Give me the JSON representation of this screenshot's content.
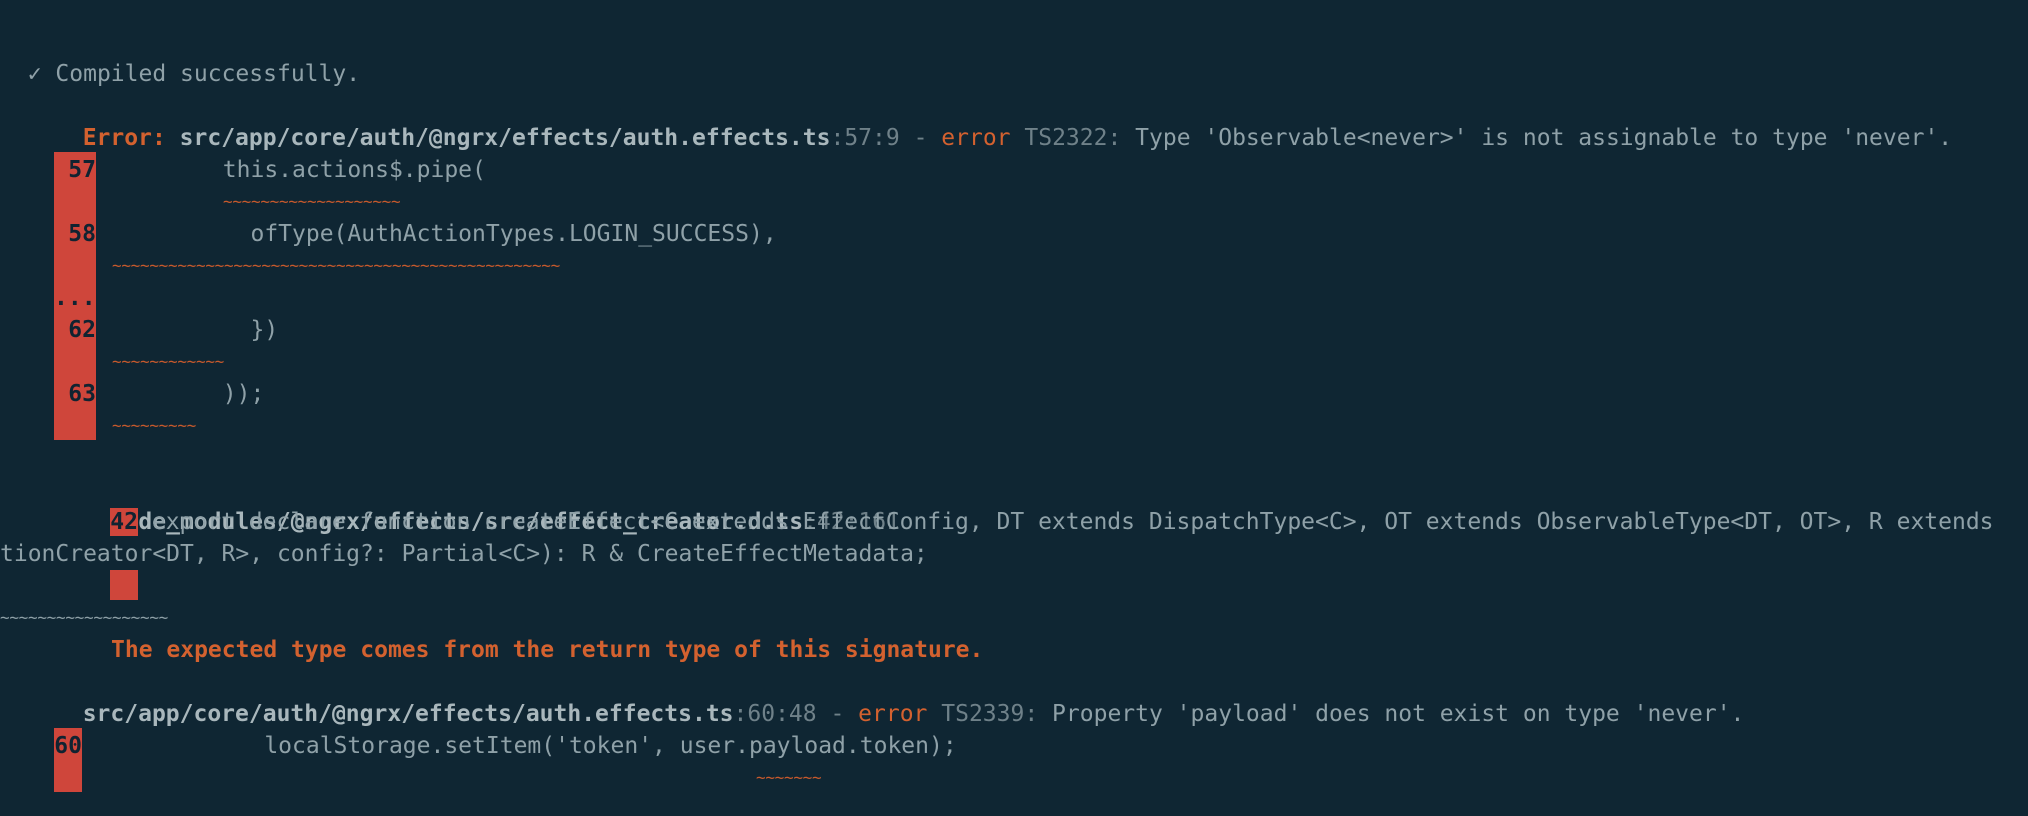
{
  "status": {
    "check_icon": "✓",
    "compiled_message": "Compiled successfully."
  },
  "colors": {
    "background": "#0f2633",
    "error": "#d3612f",
    "gutter": "#cf463b",
    "text": "#8fa1a8"
  },
  "error1": {
    "label": "Error:",
    "file": "src/app/core/auth/@ngrx/effects/auth.effects.ts",
    "position": ":57:9",
    "dash": " - ",
    "keyword": "error",
    "code": " TS2322:",
    "message": " Type 'Observable<never>' is not assignable to type 'never'.",
    "lines": [
      {
        "num": "57",
        "code": "        this.actions$.pipe(",
        "squiggle": "~~~~~~~~~~~~~~~~~~~"
      },
      {
        "num": "58",
        "code": "          ofType(AuthActionTypes.LOGIN_SUCCESS),",
        "squiggle": "~~~~~~~~~~~~~~~~~~~~~~~~~~~~~~~~~~~~~~~~~~~~~~~~"
      },
      {
        "num": "62",
        "code": "          })",
        "squiggle": "~~~~~~~~~~~~"
      },
      {
        "num": "63",
        "code": "        ));",
        "squiggle": "~~~~~~~~~"
      }
    ],
    "ellipsis": "..."
  },
  "related": {
    "file": "node_modules/@ngrx/effects/src/effect_creator.d.ts",
    "position": ":42:161",
    "line_num": "42",
    "code_line1": " export declare function createEffect<C extends EffectConfig, DT extends DispatchType<C>, OT extends ObservableType<DT, OT>, R extends",
    "code_line2": "tionCreator<DT, R>, config?: Partial<C>): R & CreateEffectMetadata;",
    "squiggle": "~~~~~~~~~~~~~~~~~~",
    "note": "The expected type comes from the return type of this signature."
  },
  "error2": {
    "file": "src/app/core/auth/@ngrx/effects/auth.effects.ts",
    "position": ":60:48",
    "dash": " - ",
    "keyword": "error",
    "code": " TS2339:",
    "message": " Property 'payload' does not exist on type 'never'.",
    "line_num": "60",
    "code_line": "           localStorage.setItem('token', user.payload.token);",
    "squiggle": "~~~~~~~"
  }
}
